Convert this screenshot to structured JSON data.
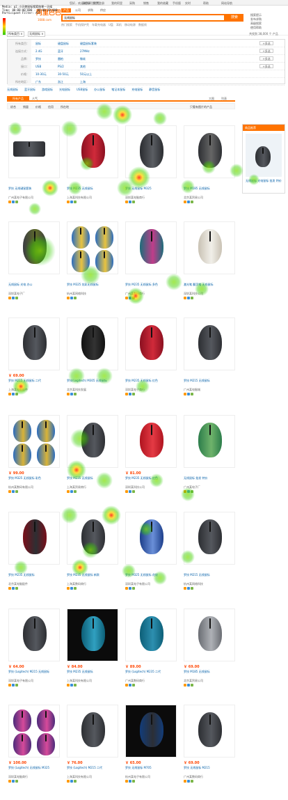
{
  "topbar": {
    "items": [
      "您好，欢迎来到阿里巴巴",
      "请登录",
      "免费注册",
      "我的阿里",
      "采购",
      "销售",
      "我的收藏",
      "手机版",
      "实时",
      "帮助",
      "网站导航"
    ]
  },
  "overlay": {
    "line1": "Media: p2_小天使鼠标搜索结果一天候",
    "line2": "Time: 00:00:00:000 - 00:00:30:000",
    "line3": "Participant Filter: All"
  },
  "logo": {
    "brand": "阿里巴巴",
    "domain": "1688.com"
  },
  "search": {
    "tabs": [
      "产品",
      "公司",
      "求购",
      "供应"
    ],
    "value": "无线鼠标",
    "button_label": "搜索",
    "hotwords": [
      "热门搜索",
      "手机保护壳",
      "车载充电器",
      "U盘",
      "耳机",
      "移动电源",
      "数据线"
    ]
  },
  "right_links": [
    "搜索提示",
    "发布求购",
    "高级搜索",
    "使用帮助"
  ],
  "breadcrumb": {
    "pill1": "所有类目 ×",
    "pill2": "无线鼠标 ×",
    "result_text": "共找到 38,000 个 产品"
  },
  "filters": [
    {
      "label": "所有类目：",
      "options": [
        "鼠标",
        "键盘鼠标",
        "键盘鼠标套装"
      ],
      "more": "+多选"
    },
    {
      "label": "连接方式：",
      "options": [
        "2.4G",
        "蓝牙",
        "27MHz"
      ],
      "more": "+多选"
    },
    {
      "label": "品牌：",
      "options": [
        "罗技",
        "雷柏",
        "微软"
      ],
      "more": "+多选"
    },
    {
      "label": "接口：",
      "options": [
        "USB",
        "PS/2",
        "其他"
      ],
      "more": "+多选"
    },
    {
      "label": "价格：",
      "options": [
        "10-30元",
        "30-50元",
        "50元以上"
      ],
      "more": ""
    },
    {
      "label": "所在地区：",
      "options": [
        "广东",
        "浙江",
        "上海"
      ],
      "more": ""
    }
  ],
  "category_links": [
    "无线鼠标",
    "蓝牙鼠标",
    "游戏鼠标",
    "光电鼠标",
    "USB鼠标",
    "办公鼠标",
    "笔记本鼠标",
    "充电鼠标",
    "静音鼠标"
  ],
  "tabs": {
    "primary": "所有产品",
    "secondary": "人气",
    "right1": "大图",
    "right2": "列表"
  },
  "sort": {
    "items": [
      "综合",
      "销量",
      "价格",
      "信用",
      "所在地"
    ],
    "checkbox": "只看有图片的产品"
  },
  "sidebar": {
    "heading": "商品推荐",
    "caption": "无线鼠标 光电鼠标 批发 特价"
  },
  "products": [
    {
      "price": "",
      "title": "罗技 无线键鼠套装",
      "vendor": "广州某电子有限公司"
    },
    {
      "price": "",
      "title": "罗技 M235 无线鼠标",
      "vendor": "上海某科技有限公司"
    },
    {
      "price": "",
      "title": "罗技 无线鼠标 M325",
      "vendor": "深圳某电脑商行"
    },
    {
      "price": "",
      "title": "罗技 M185 无线鼠标",
      "vendor": "北京某贸易公司"
    },
    {
      "price": "",
      "title": "无线鼠标 光电 办公",
      "vendor": "深圳某电子厂"
    },
    {
      "price": "",
      "title": "罗技 M325 炫彩无线鼠标",
      "vendor": "杭州某网络科技"
    },
    {
      "price": "",
      "title": "罗技 M235 无线鼠标 多色",
      "vendor": "广州某数码商行"
    },
    {
      "price": "",
      "title": "激光笔 翻页笔 无线鼠标",
      "vendor": "深圳某科技公司"
    },
    {
      "price": "￥ 69.00",
      "title": "罗技 M215 无线鼠标 二代",
      "vendor": "上海某电脑配件"
    },
    {
      "price": "",
      "title": "罗技(Logitech) M305 无线鼠标",
      "vendor": "北京某科技发展"
    },
    {
      "price": "",
      "title": "罗技 M235 无线鼠标 红色",
      "vendor": "深圳某电子商行"
    },
    {
      "price": "",
      "title": "罗技 M215 无线鼠标",
      "vendor": "广州某电脑城"
    },
    {
      "price": "￥ 99.00",
      "title": "罗技 M325 无线鼠标 彩色",
      "vendor": "杭州某数码有限公司"
    },
    {
      "price": "",
      "title": "罗技 M235 无线鼠标",
      "vendor": "上海某贸易商行"
    },
    {
      "price": "￥ 81.00",
      "title": "罗技 M235 无线鼠标 红色",
      "vendor": "深圳某科技公司"
    },
    {
      "price": "",
      "title": "无线鼠标 批发 特价",
      "vendor": "广州某电子厂"
    },
    {
      "price": "",
      "title": "罗技 M235 无线鼠标",
      "vendor": "北京某电脑配件"
    },
    {
      "price": "",
      "title": "罗技 M235 无线鼠标 新款",
      "vendor": "上海某数码商行"
    },
    {
      "price": "",
      "title": "罗技 M325 无线鼠标 花纹",
      "vendor": "深圳某电子有限公司"
    },
    {
      "price": "",
      "title": "罗技 M215 无线鼠标",
      "vendor": "杭州某网络科技"
    },
    {
      "price": "￥ 64.00",
      "title": "罗技 (Logitech) M215 无线鼠标",
      "vendor": "深圳某电子有限公司"
    },
    {
      "price": "￥ 84.00",
      "title": "罗技 M235 无线鼠标",
      "vendor": "上海某科技有限公司"
    },
    {
      "price": "￥ 89.00",
      "title": "罗技 (Logitech) M235 二代",
      "vendor": "广州某数码商行"
    },
    {
      "price": "￥ 69.00",
      "title": "罗技 M185 无线鼠标",
      "vendor": "北京某贸易公司"
    },
    {
      "price": "￥ 100.00",
      "title": "罗技 (Logitech) 无线鼠标 M325",
      "vendor": "深圳某电脑商行"
    },
    {
      "price": "￥ 76.00",
      "title": "罗技 (Logitech) M215 二代",
      "vendor": "上海某科技有限公司"
    },
    {
      "price": "￥ 65.00",
      "title": "罗技 无线鼠标 M705",
      "vendor": "杭州某电子有限公司"
    },
    {
      "price": "￥ 69.00",
      "title": "罗技 无线鼠标 M215",
      "vendor": "广州某数码商行"
    }
  ]
}
